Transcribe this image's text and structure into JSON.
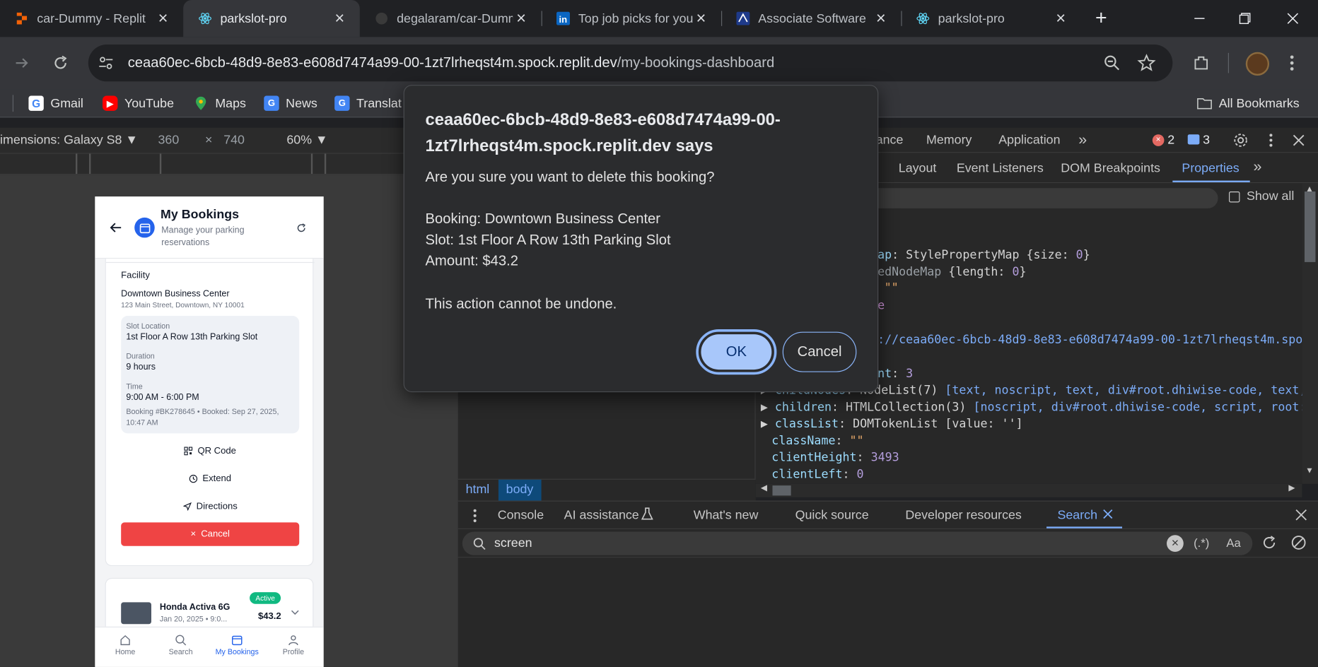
{
  "browser": {
    "tabs": [
      {
        "label": "car-Dummy - Replit"
      },
      {
        "label": "parkslot-pro"
      },
      {
        "label": "degalaram/car-Dummy"
      },
      {
        "label": "Top job picks for you"
      },
      {
        "label": "Associate Software"
      },
      {
        "label": "parkslot-pro"
      }
    ],
    "new_tab": "+",
    "url_host": "ceaa60ec-6bcb-48d9-8e83-e608d7474a99-00-1zt7lrheqst4m.spock.replit.dev",
    "url_path": "/my-bookings-dashboard",
    "bookmarks": [
      "Gmail",
      "YouTube",
      "Maps",
      "News",
      "Translat"
    ],
    "all_bookmarks": "All Bookmarks"
  },
  "devicebar": {
    "dimensions": "imensions: Galaxy S8 ▼",
    "width": "360",
    "times": "×",
    "height": "740",
    "zoom": "60% ▼"
  },
  "phone": {
    "header": {
      "title": "My Bookings",
      "subtitle": "Manage your parking reservations"
    },
    "booking": {
      "section_label": "Facility",
      "facility_name": "Downtown Business Center",
      "facility_address": "123 Main Street, Downtown, NY 10001",
      "slot_label": "Slot Location",
      "slot_value": "1st Floor A Row 13th Parking Slot",
      "duration_label": "Duration",
      "duration_value": "9 hours",
      "time_label": "Time",
      "time_value": "9:00 AM - 6:00 PM",
      "meta": "Booking #BK278645 • Booked: Sep 27, 2025, 10:47 AM",
      "qr_label": "QR Code",
      "extend_label": "Extend",
      "directions_label": "Directions",
      "cancel_label": "Cancel"
    },
    "next_booking": {
      "vehicle": "Honda Activa 6G",
      "date": "Jan 20, 2025 • 9:0...",
      "status": "Active",
      "amount": "$43.2"
    },
    "nav": [
      {
        "label": "Home"
      },
      {
        "label": "Search"
      },
      {
        "label": "My Bookings"
      },
      {
        "label": "Profile"
      }
    ],
    "colors": {
      "primary": "#2563eb",
      "danger": "#ef4444",
      "active_badge": "#10b981"
    }
  },
  "devtools": {
    "top_tabs": [
      "ance",
      "Memory",
      "Application"
    ],
    "errors": "2",
    "messages": "3",
    "sub_tabs": [
      "Layout",
      "Event Listeners",
      "DOM Breakpoints",
      "Properties"
    ],
    "show_all": "Show all",
    "breadcrumbs": [
      "html",
      "body"
    ],
    "props": {
      "l1_key": "ap",
      "l1_val": "StylePropertyMap",
      "l1_inner": "{size: ",
      "l1_num": "0",
      "l2_key": "edNodeMap",
      "l2_inner": "{length: ",
      "l2_num": "0",
      "l3_str": "\"\"",
      "l4": "e",
      "l5_url": "://ceaa60ec-6bcb-48d9-8e83-e608d7474a99-00-1zt7lrheqst4m.spo",
      "l6_key": "nt",
      "l6_num": "3",
      "childnodes_key": "childNodes",
      "childnodes_val": "NodeList(7)",
      "childnodes_items": "[text, noscript, text, div#root.dhiwise-code, text,",
      "children_key": "children",
      "children_val": "HTMLCollection(3)",
      "children_items": "[noscript, div#root.dhiwise-code, script, root:",
      "classlist_key": "classList",
      "classlist_val": "DOMTokenList",
      "classlist_items": "[value: '']",
      "classname_key": "className",
      "classname_val": "\"\"",
      "clientheight_key": "clientHeight",
      "clientheight_val": "3493",
      "clientleft_key": "clientLeft",
      "clientleft_val": "0"
    },
    "drawer_tabs": [
      "Console",
      "AI assistance",
      "What's new",
      "Quick source",
      "Developer resources",
      "Search"
    ],
    "search_query": "screen",
    "regex": "(.*)",
    "match_case": "Aa"
  },
  "dialog": {
    "title": "ceaa60ec-6bcb-48d9-8e83-e608d7474a99-00-1zt7lrheqst4m.spock.replit.dev says",
    "question": "Are you sure you want to delete this booking?",
    "booking_line": "Booking: Downtown Business Center",
    "slot_line": "Slot: 1st Floor A Row 13th Parking Slot",
    "amount_line": "Amount: $43.2",
    "warning": "This action cannot be undone.",
    "ok_label": "OK",
    "cancel_label": "Cancel"
  }
}
